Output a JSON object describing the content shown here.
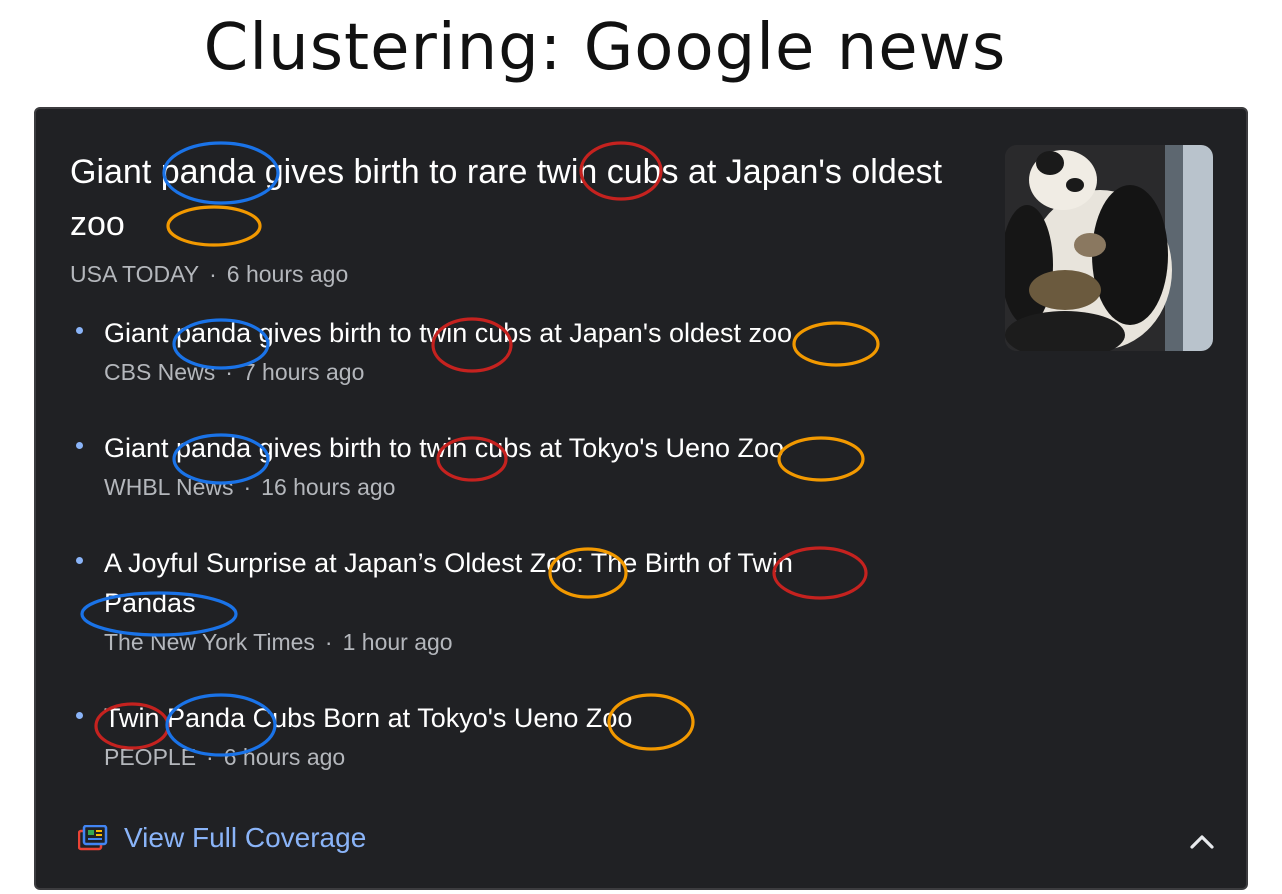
{
  "slide_title": "Clustering: Google news",
  "main_story": {
    "headline": "Giant panda gives birth to rare twin cubs at Japan's oldest zoo",
    "source": "USA TODAY",
    "time": "6 hours ago"
  },
  "related": [
    {
      "title": "Giant panda gives birth to twin cubs at Japan's oldest zoo",
      "source": "CBS News",
      "time": "7 hours ago"
    },
    {
      "title": "Giant panda gives birth to twin cubs at Tokyo's Ueno Zoo",
      "source": "WHBL News",
      "time": "16 hours ago"
    },
    {
      "title": "A Joyful Surprise at Japan’s Oldest Zoo: The Birth of Twin Pandas",
      "source": "The New York Times",
      "time": "1 hour ago"
    },
    {
      "title": "Twin Panda Cubs Born at Tokyo's Ueno Zoo",
      "source": "PEOPLE",
      "time": "6 hours ago"
    }
  ],
  "separator": "·",
  "coverage_link": "View Full Coverage",
  "icons": {
    "coverage": "full-coverage-icon",
    "collapse": "chevron-up-icon",
    "thumbnail": "panda-photo"
  },
  "colors": {
    "card_bg": "#202124",
    "link": "#8ab4f8",
    "annotation_panda": "#1a73e8",
    "annotation_twin": "#c5221f",
    "annotation_zoo": "#f29900"
  }
}
